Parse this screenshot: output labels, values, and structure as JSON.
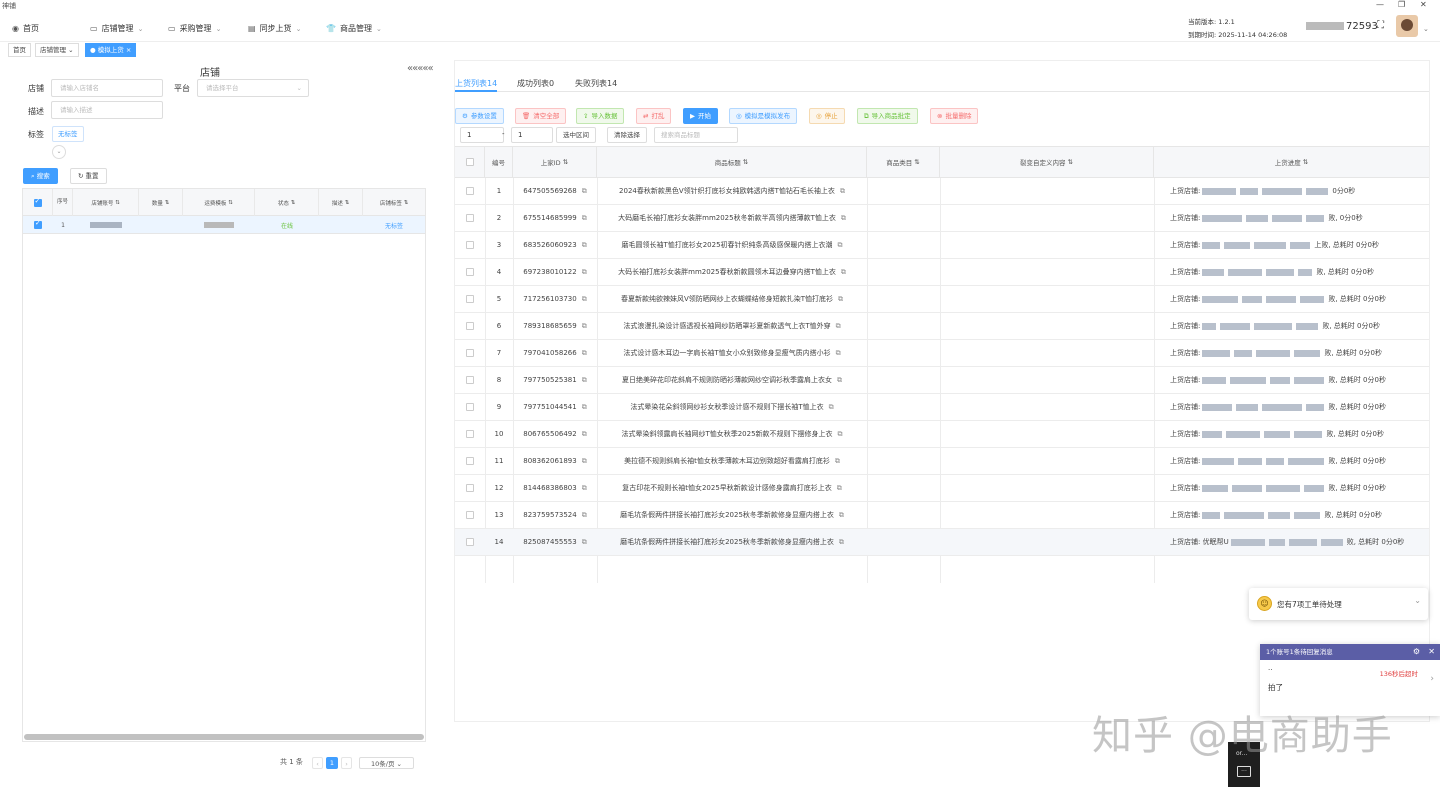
{
  "app": {
    "title": "神铺"
  },
  "menu": [
    {
      "label": "首页",
      "icon": "dashboard-icon",
      "dropdown": false
    },
    {
      "label": "店铺管理",
      "icon": "monitor-icon",
      "dropdown": true
    },
    {
      "label": "采购管理",
      "icon": "monitor-icon",
      "dropdown": true
    },
    {
      "label": "同步上货",
      "icon": "document-icon",
      "dropdown": true
    },
    {
      "label": "商品管理",
      "icon": "shirt-icon",
      "dropdown": true
    }
  ],
  "version": {
    "line1": "当前版本: 1.2.1",
    "line2": "到期时间: 2025-11-14 04:26:08"
  },
  "user": {
    "id_suffix": "72593"
  },
  "tags": [
    {
      "label": "首页",
      "active": false
    },
    {
      "label": "店铺管理",
      "active": false,
      "suffix": "⌄"
    },
    {
      "label": "模拟上货",
      "active": true,
      "suffix": "×"
    }
  ],
  "left": {
    "title": "店铺",
    "collapse_symbol": "«««««",
    "form": {
      "shop_label": "店铺",
      "shop_placeholder": "请输入店铺名",
      "platform_label": "平台",
      "platform_placeholder": "请选择平台",
      "desc_label": "描述",
      "desc_placeholder": "请输入描述",
      "tag_label": "标签",
      "tag_button": "无标签"
    },
    "search_button": "搜索",
    "reset_button": "重置",
    "table": {
      "headers": [
        "序号",
        "店铺账号",
        "数量",
        "运费模板",
        "状态",
        "描述",
        "店铺标签"
      ],
      "rows": [
        {
          "index": "1",
          "status": "在线",
          "tag": "无标签"
        }
      ]
    },
    "pager": {
      "total": "共 1 条",
      "page": "1",
      "page_size": "10条/页"
    }
  },
  "right": {
    "tabs": [
      "上货列表14",
      "成功列表0",
      "失败列表14"
    ],
    "actions": [
      {
        "label": "参数设置",
        "icon": "⚙",
        "color": "#409eff",
        "bg": "#ecf5ff",
        "border": "#b3d8ff"
      },
      {
        "label": "清空全部",
        "icon": "🗑",
        "color": "#f56c6c",
        "bg": "#fef0f0",
        "border": "#fbc4c4"
      },
      {
        "label": "导入数据",
        "icon": "⇪",
        "color": "#67c23a",
        "bg": "#f0f9eb",
        "border": "#c2e7b0"
      },
      {
        "label": "打乱",
        "icon": "⇄",
        "color": "#f56c6c",
        "bg": "#fef0f0",
        "border": "#fbc4c4"
      },
      {
        "label": "开始",
        "icon": "▶",
        "color": "#ffffff",
        "bg": "#409eff",
        "border": "#409eff"
      },
      {
        "label": "模拟是模拟发布",
        "icon": "◎",
        "color": "#409eff",
        "bg": "#ecf5ff",
        "border": "#b3d8ff"
      },
      {
        "label": "停止",
        "icon": "◎",
        "color": "#e6a23c",
        "bg": "#fdf6ec",
        "border": "#f5dab1"
      },
      {
        "label": "导入商品批定",
        "icon": "⧉",
        "color": "#67c23a",
        "bg": "#f0f9eb",
        "border": "#c2e7b0"
      },
      {
        "label": "批量删除",
        "icon": "⊗",
        "color": "#f56c6c",
        "bg": "#fef0f0",
        "border": "#fbc4c4"
      }
    ],
    "range_from": "1",
    "range_sep": "-",
    "range_to": "1",
    "select_range_button": "选中区间",
    "clear_selection_button": "清除选择",
    "search_title_placeholder": "搜索商品标题",
    "table": {
      "headers": [
        "编号",
        "上家ID",
        "商品标题",
        "商品类目",
        "裂变自定义内容",
        "上货进度"
      ],
      "rows": [
        {
          "num": "1",
          "id": "647505569268",
          "title": "2024春秋新款黑色V领针织打底衫女纯欧韩透内搭T恤钻石毛长袖上衣",
          "progress_prefix": "上货店铺:",
          "progress_suffix": "0分0秒"
        },
        {
          "num": "2",
          "id": "675514685999",
          "title": "大码磨毛长袖打底衫女装胖mm2025秋冬新款半高领内搭薄款T恤上衣",
          "progress_prefix": "上货店铺:",
          "progress_suffix": "败, 0分0秒"
        },
        {
          "num": "3",
          "id": "683526060923",
          "title": "磨毛圆领长袖T恤打底衫女2025初春针织纯条高级感保暖内搭上衣潮",
          "progress_prefix": "上货店铺:",
          "progress_suffix": "上败, 总耗时 0分0秒"
        },
        {
          "num": "4",
          "id": "697238010122",
          "title": "大码长袖打底衫女装胖mm2025春秋新款圆领木耳边叠穿内搭T恤上衣",
          "progress_prefix": "上货店铺:",
          "progress_suffix": "败, 总耗时 0分0秒"
        },
        {
          "num": "5",
          "id": "717256103730",
          "title": "春夏新款纯欲辣妹风V领防晒网纱上衣蝴蝶结修身短款扎染T恤打底衫",
          "progress_prefix": "上货店铺:",
          "progress_suffix": "败, 总耗时 0分0秒"
        },
        {
          "num": "6",
          "id": "789318685659",
          "title": "法式浪漫扎染设计感透视长袖网纱防晒罩衫夏新款透气上衣T恤外穿",
          "progress_prefix": "上货店铺:",
          "progress_suffix": "败, 总耗时 0分0秒"
        },
        {
          "num": "7",
          "id": "797041058266",
          "title": "法式设计感木耳边一字肩长袖T恤女小众别致修身显瘦气质内搭小衫",
          "progress_prefix": "上货店铺:",
          "progress_suffix": "败, 总耗时 0分0秒"
        },
        {
          "num": "8",
          "id": "797750525381",
          "title": "夏日绝美碎花印花斜肩不规则防晒衫薄款网纱空调衫秋季露肩上衣女",
          "progress_prefix": "上货店铺:",
          "progress_suffix": "败, 总耗时 0分0秒"
        },
        {
          "num": "9",
          "id": "797751044541",
          "title": "法式晕染花朵斜领网纱衫女秋季设计感不规则下摆长袖T恤上衣",
          "progress_prefix": "上货店铺:",
          "progress_suffix": "败, 总耗时 0分0秒"
        },
        {
          "num": "10",
          "id": "806765506492",
          "title": "法式晕染斜领露肩长袖网纱T恤女秋季2025新款不规则下摆修身上衣",
          "progress_prefix": "上货店铺:",
          "progress_suffix": "败, 总耗时 0分0秒"
        },
        {
          "num": "11",
          "id": "808362061893",
          "title": "美拉德不规则斜肩长袖t恤女秋季薄款木耳边别致超好看露肩打底衫",
          "progress_prefix": "上货店铺:",
          "progress_suffix": "败, 总耗时 0分0秒"
        },
        {
          "num": "12",
          "id": "814468386803",
          "title": "复古印花不规则长袖t恤女2025早秋新款设计感修身露肩打底衫上衣",
          "progress_prefix": "上货店铺:",
          "progress_suffix": "败, 总耗时 0分0秒"
        },
        {
          "num": "13",
          "id": "823759573524",
          "title": "磨毛坑条假两件拼接长袖打底衫女2025秋冬季新款修身显瘦内搭上衣",
          "progress_prefix": "上货店铺:",
          "progress_suffix": "败, 总耗时 0分0秒"
        },
        {
          "num": "14",
          "id": "825087455553",
          "title": "磨毛坑条假两件拼接长袖打底衫女2025秋冬季新款修身显瘦内搭上衣",
          "progress_prefix": "上货店铺: 优眠帮U",
          "progress_suffix": "败, 总耗时 0分0秒"
        }
      ]
    }
  },
  "notification": {
    "text": "您有7项工单待处理"
  },
  "message": {
    "header": "1个账号1条待回复消息",
    "sender": "..",
    "timeout": "136秒后超时",
    "body": "拍了"
  },
  "dock": {
    "label": "or..."
  },
  "watermark": "知乎 @电商助手"
}
